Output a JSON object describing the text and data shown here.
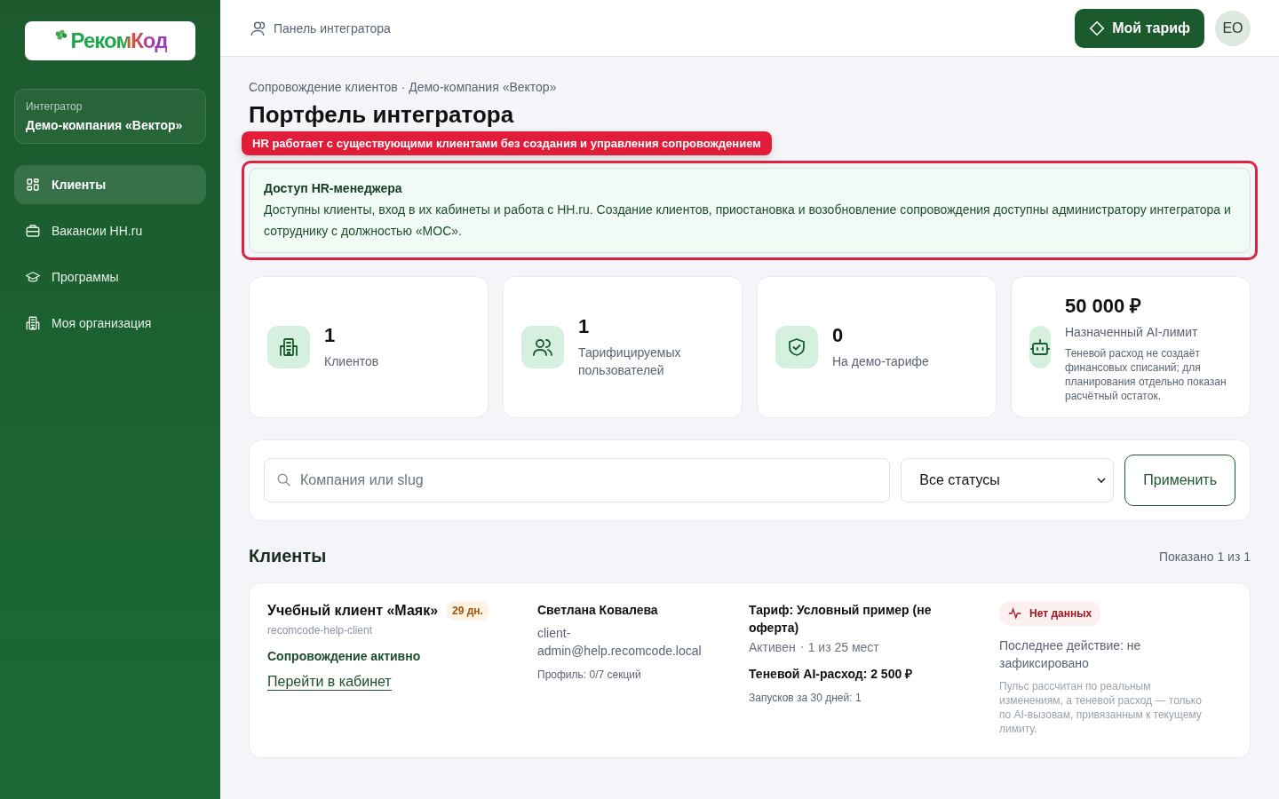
{
  "sidebar": {
    "logo": "РекомКод",
    "org": {
      "label": "Интегратор",
      "name": "Демо-компания «Вектор»"
    },
    "items": [
      {
        "label": "Клиенты",
        "selected": true
      },
      {
        "label": "Вакансии HH.ru",
        "selected": false
      },
      {
        "label": "Программы",
        "selected": false
      },
      {
        "label": "Моя организация",
        "selected": false
      }
    ]
  },
  "topbar": {
    "title": "Панель интегратора",
    "plan_button": "Мой тариф",
    "avatar": "ЕО"
  },
  "breadcrumb": "Сопровождение клиентов · Демо-компания «Вектор»",
  "page_title": "Портфель интегратора",
  "annotation": "HR работает с существующими клиентами без создания и управления сопровождением",
  "notice": {
    "title": "Доступ HR-менеджера",
    "text": "Доступны клиенты, вход в их кабинеты и работа с HH.ru. Создание клиентов, приостановка и возобновление сопровождения доступны администратору интегратора и сотруднику с должностью «МОС»."
  },
  "stats": [
    {
      "value": "1",
      "label": "Клиентов"
    },
    {
      "value": "1",
      "label": "Тарифицируемых пользователей"
    },
    {
      "value": "0",
      "label": "На демо-тарифе"
    },
    {
      "value": "50 000 ₽",
      "label": "Назначенный AI-лимит",
      "note": "Теневой расход не создаёт финансовых списаний; для планирования отдельно показан расчётный остаток."
    }
  ],
  "filters": {
    "search_placeholder": "Компания или slug",
    "status": "Все статусы",
    "apply": "Применить"
  },
  "clients_section": {
    "title": "Клиенты",
    "count": "Показано 1 из 1"
  },
  "clients": [
    {
      "name": "Учебный клиент «Маяк»",
      "days": "29 дн.",
      "slug": "recomcode-help-client",
      "status": "Сопровождение активно",
      "link": "Перейти в кабинет",
      "contact_name": "Светлана Ковалева",
      "contact_email": "client-admin@help.recomcode.local",
      "profile": "Профиль: 0/7 секций",
      "tariff": "Тариф: Условный пример (не оферта)",
      "tariff_status": "Активен",
      "seats": "1 из 25 мест",
      "shadow": "Теневой AI-расход: 2 500 ₽",
      "runs": "Запусков за 30 дней: 1",
      "pulse": "Нет данных",
      "last_action": "Последнее действие: не зафиксировано",
      "pulse_note": "Пульс рассчитан по реальным изменениям, а теневой расход — только по AI-вызовам, привязанным к текущему лимиту."
    }
  ]
}
